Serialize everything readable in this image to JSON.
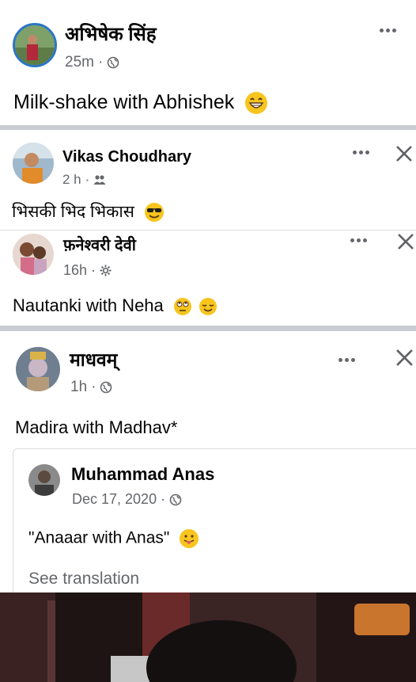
{
  "posts": [
    {
      "author": "अभिषेक सिंह",
      "time": "25m",
      "audience_icon": "globe-icon",
      "text": "Milk-shake with Abhishek",
      "emoji": "grinning-face-emoji"
    },
    {
      "author": "Vikas Choudhary",
      "time": "2 h",
      "audience_icon": "friends-icon",
      "text": "भिसकी भिद भिकास",
      "emoji": "sunglasses-face-emoji"
    },
    {
      "author": "फ़नेश्वरी देवी",
      "time": "16h",
      "audience_icon": "settings-icon",
      "text": "Nautanki with Neha",
      "emoji": "eye-roll-and-relieved-emoji"
    },
    {
      "author": "माधवम्",
      "time": "1h",
      "audience_icon": "globe-icon",
      "text": "Madira with Madhav*",
      "shared": {
        "author": "Muhammad Anas",
        "time": "Dec 17, 2020",
        "audience_icon": "globe-icon",
        "text": "\"Anaaar with Anas\"",
        "emoji": "tongue-out-emoji",
        "see_translation": "See translation"
      }
    }
  ],
  "separator": "·",
  "colors": {
    "divider": "#c9ccd1",
    "meta": "#65676b",
    "text": "#050505",
    "emoji": "#f7c51e"
  }
}
